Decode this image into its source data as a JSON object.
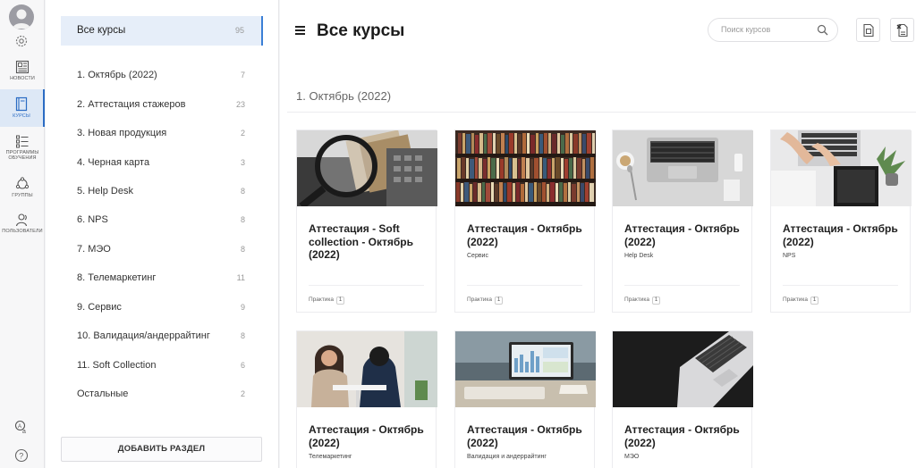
{
  "rail": {
    "items": [
      {
        "label": "Новости",
        "icon": "news-icon"
      },
      {
        "label": "Курсы",
        "icon": "courses-icon"
      },
      {
        "label": "Программы обучения",
        "icon": "programs-icon"
      },
      {
        "label": "Группы",
        "icon": "groups-icon"
      },
      {
        "label": "Пользователи",
        "icon": "users-icon"
      }
    ],
    "active": "Курсы",
    "accent": "#2b6cc4"
  },
  "sections": {
    "all": {
      "name": "Все курсы",
      "count": "95"
    },
    "items": [
      {
        "name": "1. Октябрь (2022)",
        "count": "7"
      },
      {
        "name": "2. Аттестация стажеров",
        "count": "23"
      },
      {
        "name": "3. Новая продукция",
        "count": "2"
      },
      {
        "name": "4. Черная карта",
        "count": "3"
      },
      {
        "name": "5. Help Desk",
        "count": "8"
      },
      {
        "name": "6. NPS",
        "count": "8"
      },
      {
        "name": "7. МЭО",
        "count": "8"
      },
      {
        "name": "8. Телемаркетинг",
        "count": "11"
      },
      {
        "name": "9. Сервис",
        "count": "9"
      },
      {
        "name": "10. Валидация/андеррайтинг",
        "count": "8"
      },
      {
        "name": "11. Soft Collection",
        "count": "6"
      },
      {
        "name": "Остальные",
        "count": "2"
      }
    ],
    "add_button": "ДОБАВИТЬ РАЗДЕЛ"
  },
  "main": {
    "title": "Все курсы",
    "search_placeholder": "Поиск курсов",
    "section_heading": "1. Октябрь (2022)",
    "cards": [
      {
        "title": "Аттестация - Soft collection - Октябрь (2022)",
        "subtitle": "",
        "type": "Практика",
        "type_count": "1",
        "image": "magnifier-money"
      },
      {
        "title": "Аттестация - Октябрь (2022)",
        "subtitle": "Сервис",
        "type": "Практика",
        "type_count": "1",
        "image": "bookshelf"
      },
      {
        "title": "Аттестация - Октябрь (2022)",
        "subtitle": "Help Desk",
        "type": "Практика",
        "type_count": "1",
        "image": "laptop-desk"
      },
      {
        "title": "Аттестация - Октябрь (2022)",
        "subtitle": "NPS",
        "type": "Практика",
        "type_count": "1",
        "image": "typing-hands"
      },
      {
        "title": "Аттестация - Октябрь (2022)",
        "subtitle": "Телемаркетинг",
        "type": "",
        "type_count": "",
        "image": "meeting"
      },
      {
        "title": "Аттестация - Октябрь (2022)",
        "subtitle": "Валидация и андеррайтинг",
        "type": "",
        "type_count": "",
        "image": "dashboard-laptop"
      },
      {
        "title": "Аттестация - Октябрь (2022)",
        "subtitle": "МЭО",
        "type": "",
        "type_count": "",
        "image": "dark-laptop"
      }
    ]
  }
}
